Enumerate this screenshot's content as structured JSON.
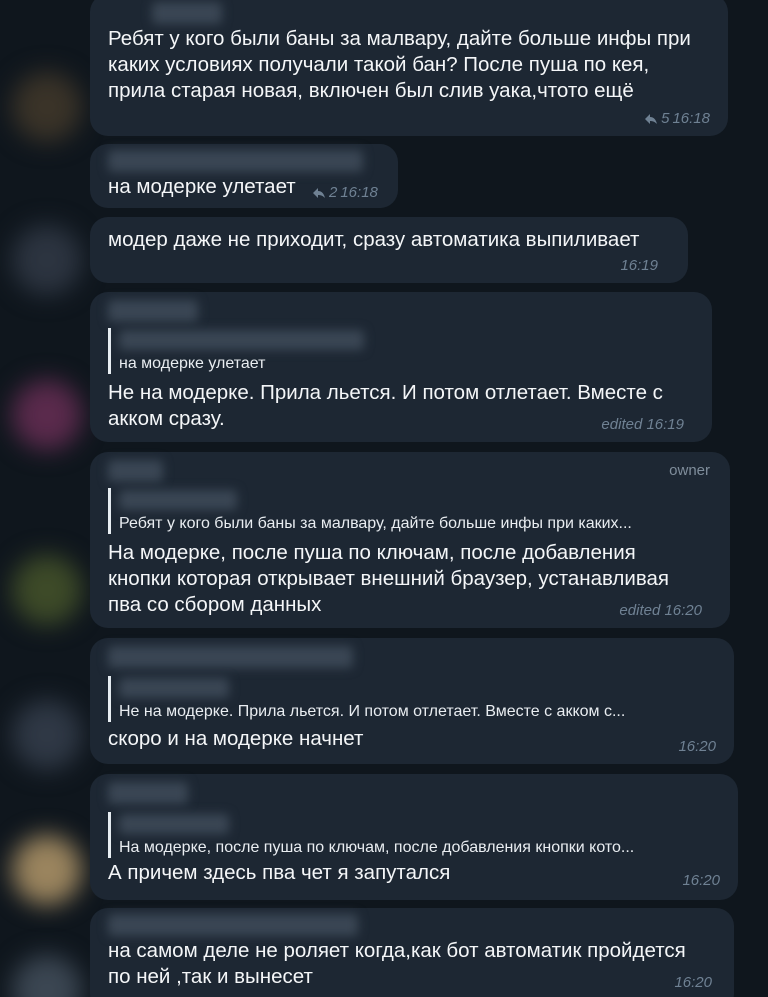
{
  "messages": [
    {
      "id": "m1",
      "lines": [
        "Ребят у кого были баны за малвару, дайте больше инфы при",
        "каких условиях получали такой бан? После пуша по кея,",
        "прила старая новая, включен был слив уака,чтото ещё"
      ],
      "reply_count": "5",
      "time": "16:18"
    },
    {
      "id": "m2",
      "lines": [
        "на модерке улетает"
      ],
      "reply_count": "2",
      "time": "16:18"
    },
    {
      "id": "m3",
      "lines": [
        "модер даже не приходит, сразу автоматика выпиливает"
      ],
      "time": "16:19"
    },
    {
      "id": "m4",
      "quote": "на модерке улетает",
      "lines": [
        "Не на модерке.  Прила льется. И потом отлетает.  Вместе с",
        "акком сразу."
      ],
      "time": "edited 16:19"
    },
    {
      "id": "m5",
      "role": "owner",
      "quote": "Ребят у кого были баны за малвару, дайте больше инфы при каких...",
      "lines": [
        "На модерке, после пуша по ключам, после добавления",
        "кнопки которая открывает внешний браузер, устанавливая",
        "пва со сбором данных"
      ],
      "time": "edited 16:20"
    },
    {
      "id": "m6",
      "quote": "Не на модерке.  Прила льется. И потом отлетает.  Вместе с акком с...",
      "lines": [
        "скоро и на модерке начнет"
      ],
      "time": "16:20"
    },
    {
      "id": "m7",
      "quote": "На модерке, после пуша по ключам, после добавления кнопки кото...",
      "lines": [
        "А причем здесь пва чет я запутался"
      ],
      "time": "16:20"
    },
    {
      "id": "m8",
      "lines": [
        "на самом деле не роляет когда,как бот автоматик пройдется",
        "по ней ,так  и вынесет"
      ],
      "time": "16:20"
    }
  ],
  "icons": {
    "reply": "reply-arrow-icon"
  },
  "colors": {
    "background": "#0f161d",
    "bubble": "#1d2733",
    "meta": "#6f8193"
  }
}
